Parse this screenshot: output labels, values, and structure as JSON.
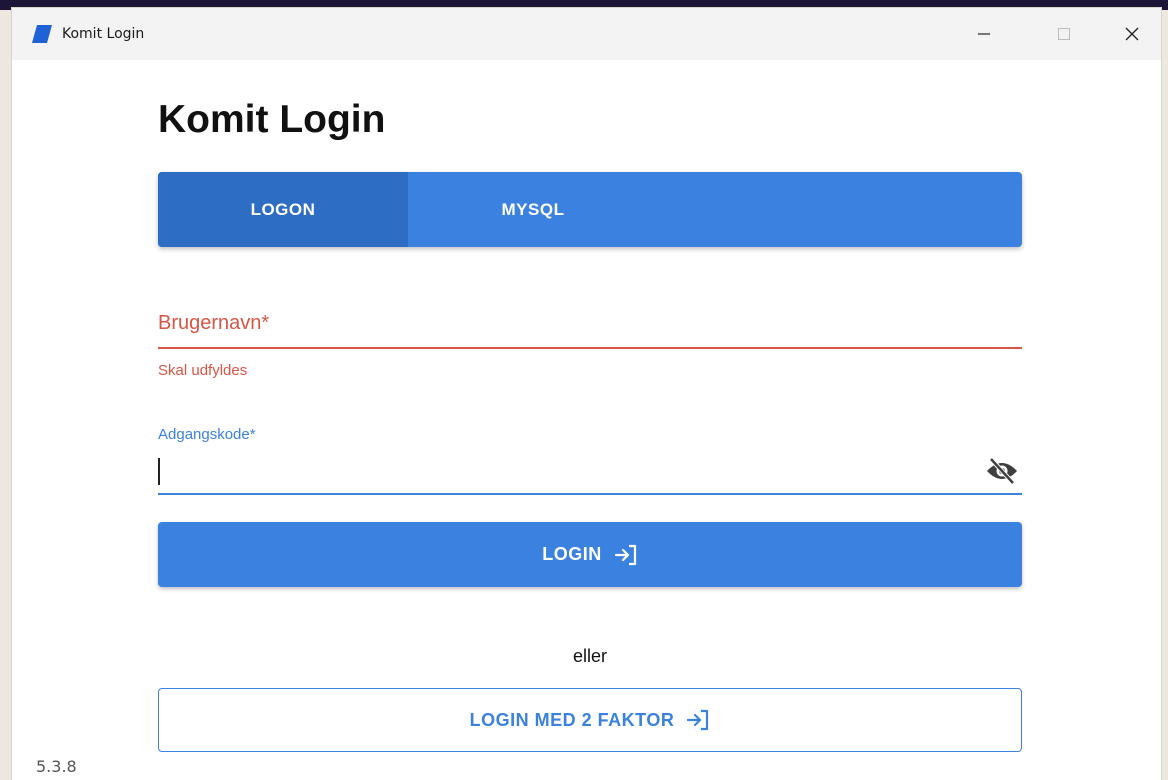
{
  "window": {
    "title": "Komit Login",
    "accent_color": "#3b82e0",
    "error_color": "#d95545"
  },
  "page": {
    "title": "Komit Login"
  },
  "tabs": [
    {
      "label": "LOGON",
      "active": true
    },
    {
      "label": "MYSQL",
      "active": false
    }
  ],
  "username": {
    "label": "Brugernavn*",
    "value": "",
    "error": "Skal udfyldes"
  },
  "password": {
    "label": "Adgangskode*",
    "value": "",
    "toggle_icon": "eye-off-icon"
  },
  "actions": {
    "login_label": "LOGIN",
    "or_label": "eller",
    "login_2fa_label": "LOGIN MED 2 FAKTOR",
    "login_icon": "login-arrow-icon"
  },
  "version": "5.3.8"
}
